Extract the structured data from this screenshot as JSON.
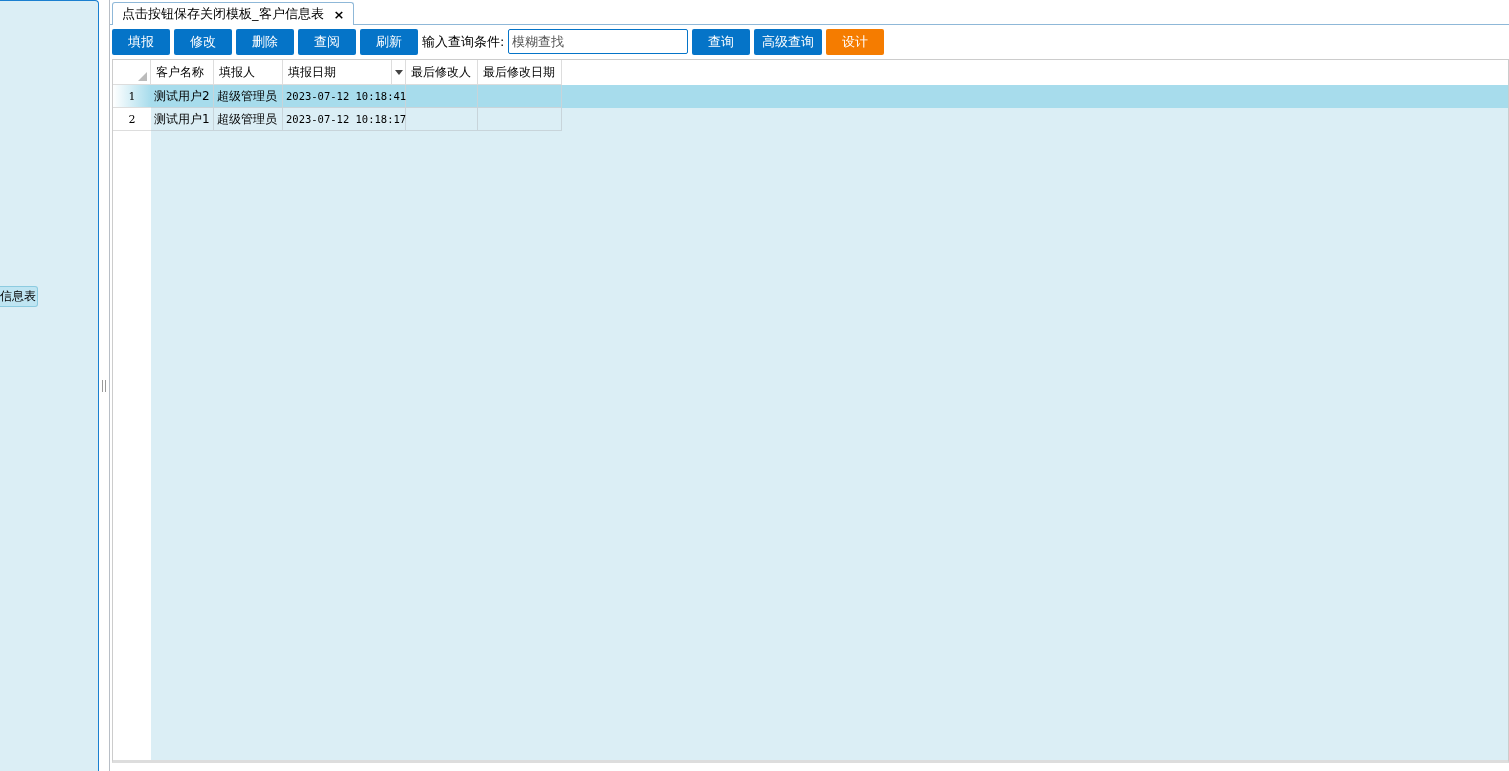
{
  "sidebar": {
    "items": [
      {
        "label": "信息表",
        "selected": true
      }
    ]
  },
  "tabs": [
    {
      "label": "点击按钮保存关闭模板_客户信息表",
      "close": "×",
      "selected": true
    }
  ],
  "toolbar": {
    "items": [
      {
        "kind": "button",
        "label": "填报"
      },
      {
        "kind": "button",
        "label": "修改"
      },
      {
        "kind": "button",
        "label": "删除"
      },
      {
        "kind": "button",
        "label": "查阅"
      },
      {
        "kind": "button",
        "label": "刷新"
      },
      {
        "kind": "label",
        "label": "输入查询条件:"
      },
      {
        "kind": "field",
        "placeholder": "模糊查找"
      },
      {
        "kind": "button",
        "label": "查询"
      },
      {
        "kind": "button",
        "label": "高级查询"
      },
      {
        "kind": "accent",
        "label": "设计"
      }
    ]
  },
  "table": {
    "columns": [
      {
        "label": "客户名称",
        "menu": false
      },
      {
        "label": "填报人",
        "menu": false
      },
      {
        "label": "填报日期",
        "menu": true
      },
      {
        "label": "最后修改人",
        "menu": false
      },
      {
        "label": "最后修改日期",
        "menu": false
      }
    ],
    "rows": [
      {
        "number": "1",
        "selected": true,
        "cells": [
          "测试用户2",
          "超级管理员",
          "2023-07-12 10:18:41",
          "",
          ""
        ]
      },
      {
        "number": "2",
        "selected": false,
        "cells": [
          "测试用户1",
          "超级管理员",
          "2023-07-12 10:18:17",
          "",
          ""
        ]
      }
    ]
  }
}
